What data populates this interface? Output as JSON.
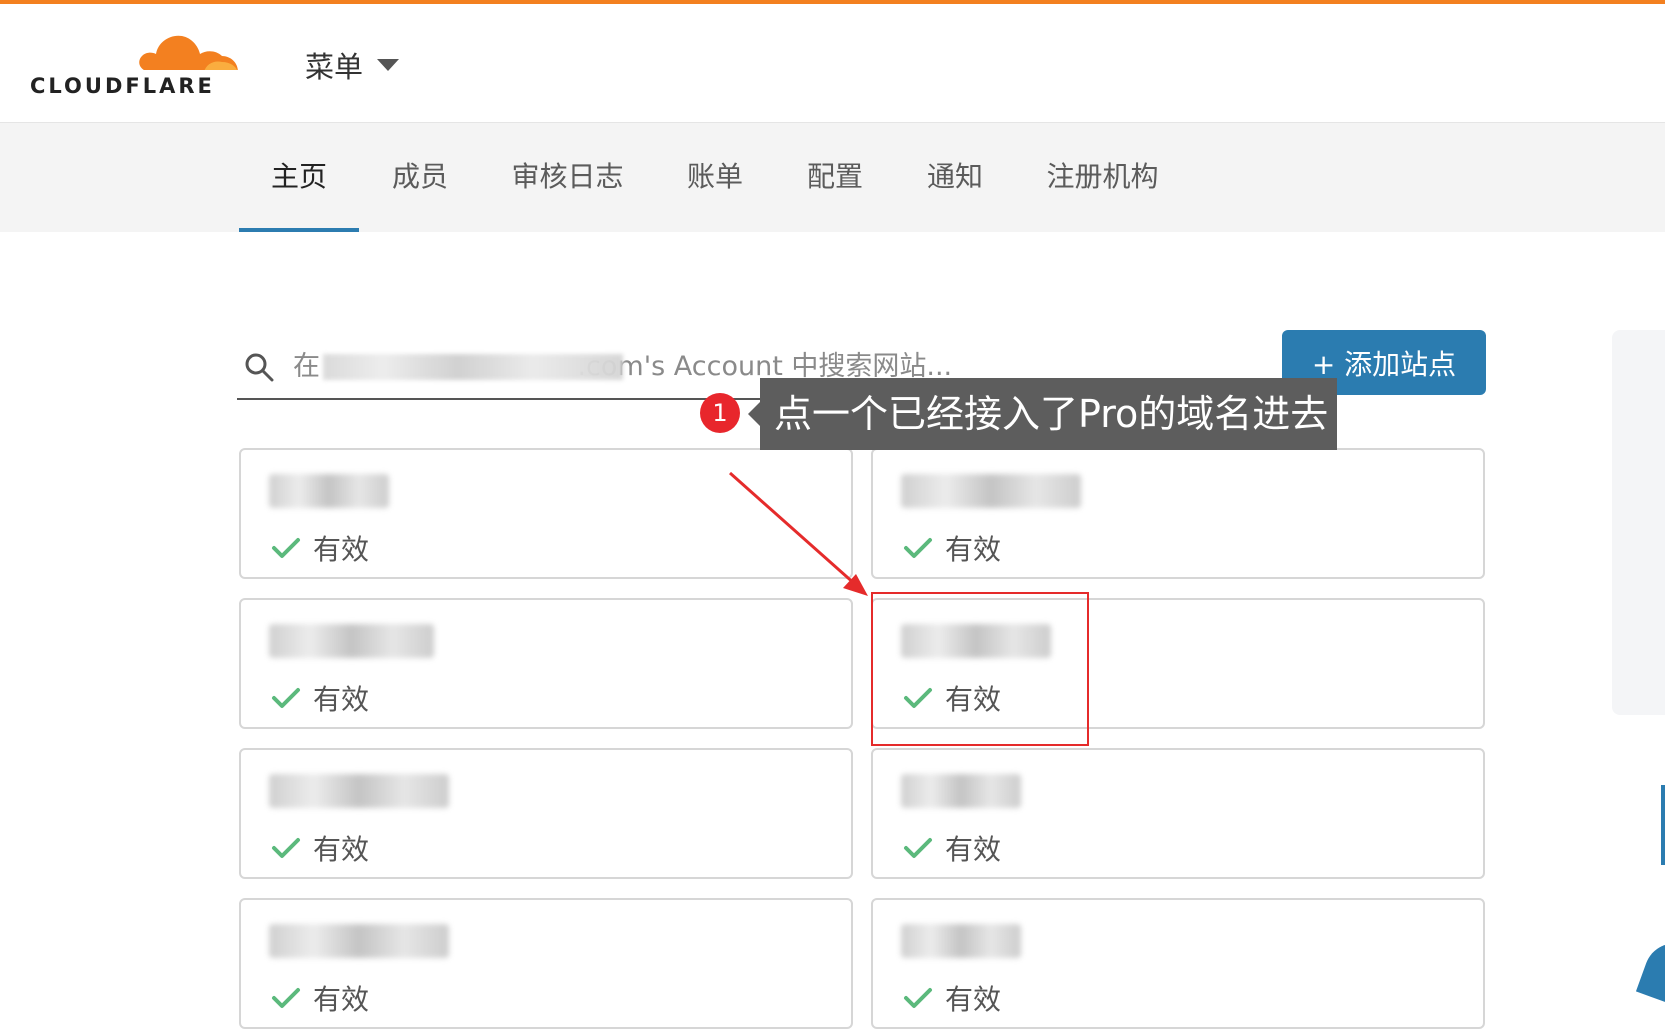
{
  "header": {
    "logo_text": "CLOUDFLARE",
    "menu_label": "菜单"
  },
  "tabs": [
    {
      "label": "主页",
      "active": true
    },
    {
      "label": "成员",
      "active": false
    },
    {
      "label": "审核日志",
      "active": false
    },
    {
      "label": "账单",
      "active": false
    },
    {
      "label": "配置",
      "active": false
    },
    {
      "label": "通知",
      "active": false
    },
    {
      "label": "注册机构",
      "active": false
    }
  ],
  "search": {
    "placeholder": "在                              .com's Account 中搜索网站..."
  },
  "add_site_label": "+ 添加站点",
  "sites": [
    {
      "status": "有效"
    },
    {
      "status": "有效"
    },
    {
      "status": "有效"
    },
    {
      "status": "有效"
    },
    {
      "status": "有效"
    },
    {
      "status": "有效"
    },
    {
      "status": "有效"
    },
    {
      "status": "有效"
    }
  ],
  "annotation": {
    "step": "1",
    "text": "点一个已经接入了Pro的域名进去"
  },
  "colors": {
    "brand_orange": "#f38020",
    "accent_blue": "#2b7cb0",
    "status_green": "#5bb97c",
    "annotation_red": "#e52b2b"
  }
}
